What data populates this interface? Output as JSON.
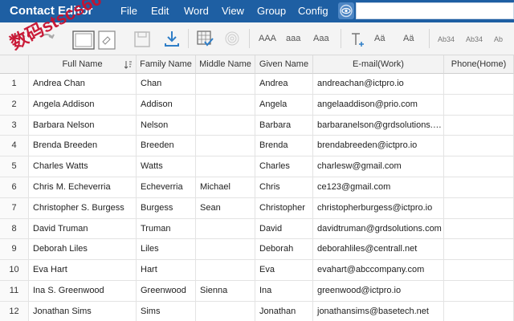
{
  "app": {
    "title": "Contact Editor"
  },
  "menu": [
    "File",
    "Edit",
    "Word",
    "View",
    "Group",
    "Config"
  ],
  "search": {
    "placeholder": ""
  },
  "toolbar": {
    "font_case_labels": [
      "AAA",
      "aaa",
      "Aaa"
    ],
    "format_labels": [
      "Aä",
      "Aä"
    ],
    "numeric_labels": [
      "Ab34",
      "Ab34",
      "Ab"
    ]
  },
  "watermark": "数码stscs66",
  "table": {
    "columns": [
      "",
      "Full Name",
      "Family Name",
      "Middle Name",
      "Given Name",
      "E-mail(Work)",
      "Phone(Home)"
    ],
    "rows": [
      {
        "num": "1",
        "full": "Andrea Chan",
        "family": "Chan",
        "middle": "",
        "given": "Andrea",
        "email": "andreachan@ictpro.io",
        "phone": ""
      },
      {
        "num": "2",
        "full": "Angela Addison",
        "family": "Addison",
        "middle": "",
        "given": "Angela",
        "email": "angelaaddison@prio.com",
        "phone": ""
      },
      {
        "num": "3",
        "full": "Barbara Nelson",
        "family": "Nelson",
        "middle": "",
        "given": "Barbara",
        "email": "barbaranelson@grdsolutions.c...",
        "phone": ""
      },
      {
        "num": "4",
        "full": "Brenda Breeden",
        "family": "Breeden",
        "middle": "",
        "given": "Brenda",
        "email": "brendabreeden@ictpro.io",
        "phone": ""
      },
      {
        "num": "5",
        "full": "Charles Watts",
        "family": "Watts",
        "middle": "",
        "given": "Charles",
        "email": "charlesw@gmail.com",
        "phone": ""
      },
      {
        "num": "6",
        "full": "Chris M. Echeverria",
        "family": "Echeverria",
        "middle": "Michael",
        "given": "Chris",
        "email": "ce123@gmail.com",
        "phone": ""
      },
      {
        "num": "7",
        "full": "Christopher S. Burgess",
        "family": "Burgess",
        "middle": "Sean",
        "given": "Christopher",
        "email": "christopherburgess@ictpro.io",
        "phone": ""
      },
      {
        "num": "8",
        "full": "David Truman",
        "family": "Truman",
        "middle": "",
        "given": "David",
        "email": "davidtruman@grdsolutions.com",
        "phone": ""
      },
      {
        "num": "9",
        "full": "Deborah Liles",
        "family": "Liles",
        "middle": "",
        "given": "Deborah",
        "email": "deborahliles@centrall.net",
        "phone": ""
      },
      {
        "num": "10",
        "full": "Eva Hart",
        "family": "Hart",
        "middle": "",
        "given": "Eva",
        "email": "evahart@abccompany.com",
        "phone": ""
      },
      {
        "num": "11",
        "full": "Ina S. Greenwood",
        "family": "Greenwood",
        "middle": "Sienna",
        "given": "Ina",
        "email": "greenwood@ictpro.io",
        "phone": ""
      },
      {
        "num": "12",
        "full": "Jonathan Sims",
        "family": "Sims",
        "middle": "",
        "given": "Jonathan",
        "email": "jonathansims@basetech.net",
        "phone": ""
      }
    ]
  },
  "colors": {
    "menubar": "#1e5fa3",
    "accent": "#2f7ec7",
    "watermark": "#c8102e"
  }
}
